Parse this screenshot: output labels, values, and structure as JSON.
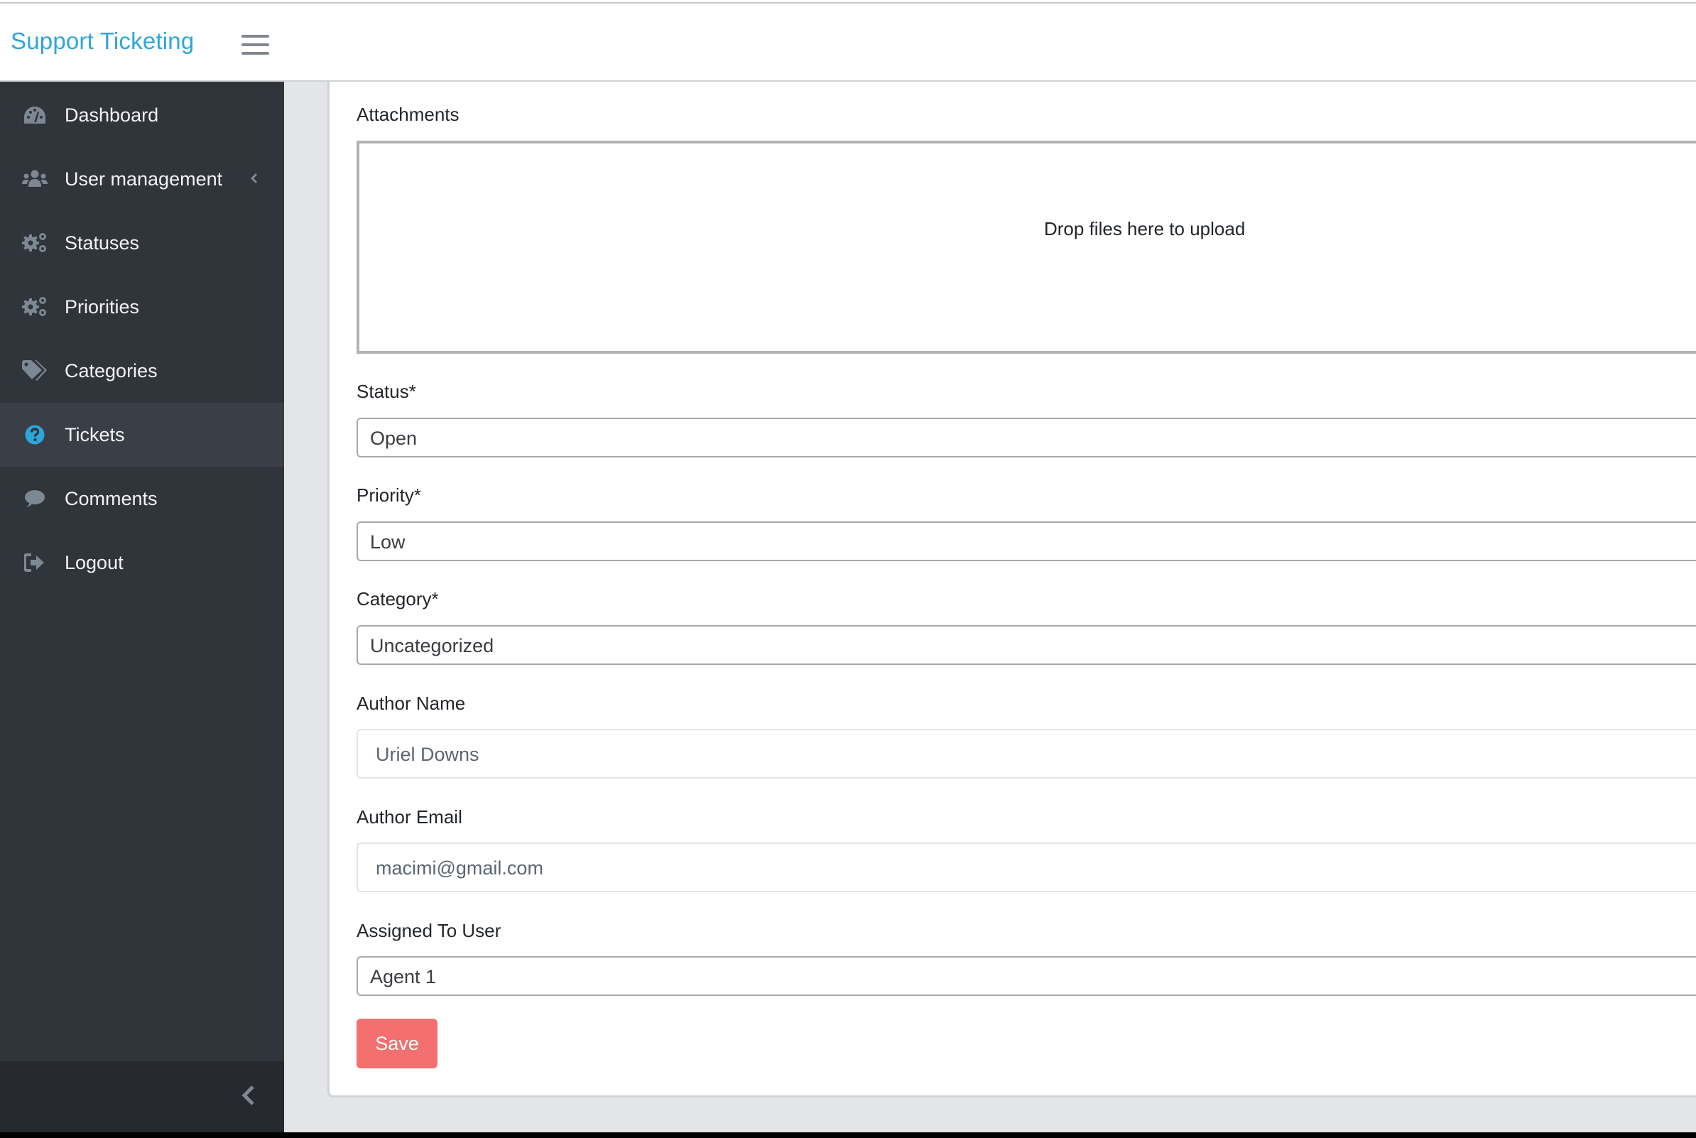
{
  "app": {
    "title": "Support Ticketing",
    "brand_color": "#2ea6d8"
  },
  "sidebar": {
    "items": [
      {
        "label": "Dashboard",
        "icon": "dashboard-gauge-icon",
        "active": false
      },
      {
        "label": "User management",
        "icon": "users-icon",
        "active": false,
        "has_submenu": true
      },
      {
        "label": "Statuses",
        "icon": "cogs-icon",
        "active": false
      },
      {
        "label": "Priorities",
        "icon": "cogs-icon",
        "active": false
      },
      {
        "label": "Categories",
        "icon": "tags-icon",
        "active": false
      },
      {
        "label": "Tickets",
        "icon": "question-circle-icon",
        "active": true
      },
      {
        "label": "Comments",
        "icon": "comment-icon",
        "active": false
      },
      {
        "label": "Logout",
        "icon": "sign-out-icon",
        "active": false
      }
    ]
  },
  "form": {
    "attachments": {
      "label": "Attachments",
      "dropzone_text": "Drop files here to upload"
    },
    "status": {
      "label": "Status*",
      "value": "Open"
    },
    "priority": {
      "label": "Priority*",
      "value": "Low"
    },
    "category": {
      "label": "Category*",
      "value": "Uncategorized"
    },
    "author_name": {
      "label": "Author Name",
      "value": "Uriel Downs"
    },
    "author_email": {
      "label": "Author Email",
      "value": "macimi@gmail.com"
    },
    "assigned_to": {
      "label": "Assigned To User",
      "value": "Agent 1"
    },
    "save_label": "Save",
    "save_color": "#f46f6f"
  }
}
